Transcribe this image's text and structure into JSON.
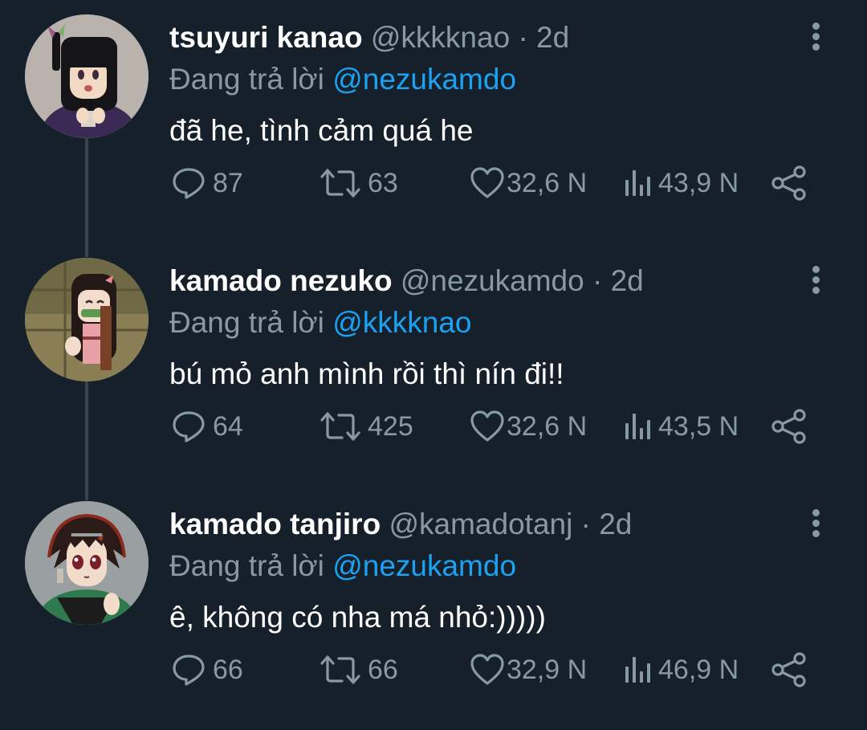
{
  "colors": {
    "background": "#15202b",
    "text_primary": "#ffffff",
    "text_secondary": "#8899a6",
    "accent": "#1da1f2",
    "thread_line": "#38444d"
  },
  "reply_prefix": "Đang trả lời",
  "separator": "·",
  "icons": {
    "reply": "reply-icon",
    "retweet": "retweet-icon",
    "like": "like-icon",
    "views": "views-icon",
    "share": "share-icon",
    "more": "more-icon"
  },
  "tweets": [
    {
      "name": "tsuyuri kanao",
      "handle": "@kkkknao",
      "time": "2d",
      "replying_to": "@nezukamdo",
      "text": "đã he, tình cảm quá he",
      "replies": "87",
      "retweets": "63",
      "likes": "32,6 N",
      "views": "43,9 N"
    },
    {
      "name": "kamado nezuko",
      "handle": "@nezukamdo",
      "time": "2d",
      "replying_to": "@kkkknao",
      "text": "bú mỏ anh mình rồi thì nín đi!!",
      "replies": "64",
      "retweets": "425",
      "likes": "32,6 N",
      "views": "43,5 N"
    },
    {
      "name": "kamado tanjiro",
      "handle": "@kamadotanj",
      "time": "2d",
      "replying_to": "@nezukamdo",
      "text": "ê, không có nha má nhỏ:)))))",
      "replies": "66",
      "retweets": "66",
      "likes": "32,9 N",
      "views": "46,9 N"
    }
  ]
}
